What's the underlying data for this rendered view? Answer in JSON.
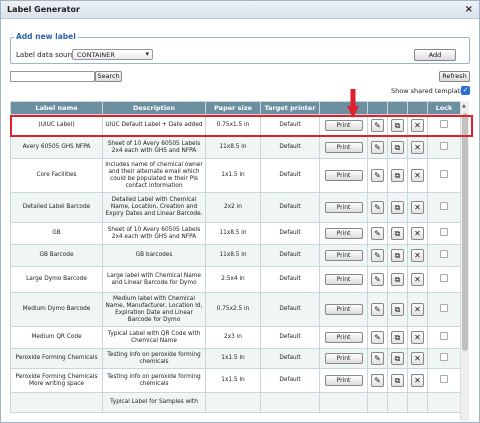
{
  "window": {
    "title": "Label Generator",
    "close": "×"
  },
  "add_section": {
    "legend": "Add new label",
    "source_label": "Label data source:",
    "source_value": "CONTAINER",
    "add_label": "Add"
  },
  "search": {
    "button": "Search",
    "value": ""
  },
  "refresh_label": "Refresh",
  "shared_templates": {
    "label": "Show shared templates:",
    "checked": true
  },
  "table": {
    "headers": [
      "Label name",
      "Description",
      "Paper size",
      "Target printer",
      "",
      "",
      "",
      "",
      "Lock"
    ],
    "print_label": "Print",
    "rows": [
      {
        "name": "(UIUC Label)",
        "desc": "UIUC Default Label + Date added",
        "paper": "0.75x1.5 in",
        "printer": "Default"
      },
      {
        "name": "Avery 60505 GHS NFPA",
        "desc": "Sheet of 10 Avery 60505 Labels 2x4 each with GHS and NFPA",
        "paper": "11x8.5 in",
        "printer": "Default"
      },
      {
        "name": "Core Facilities",
        "desc": "Includes name of chemical owner and their alternate email which could be populated w their PIs contact information",
        "paper": "1x1.5 in",
        "printer": "Default"
      },
      {
        "name": "Detailed Label Barcode",
        "desc": "Detailed Label with Chemical Name, Location, Creation and Expiry Dates and Linear Barcode.",
        "paper": "2x2 in",
        "printer": "Default"
      },
      {
        "name": "GB",
        "desc": "Sheet of 10 Avery 60505 Labels 2x4 each with GHS and NFPA",
        "paper": "11x8.5 in",
        "printer": "Default"
      },
      {
        "name": "GB Barcode",
        "desc": "GB barcodes",
        "paper": "11x8.5 in",
        "printer": "Default"
      },
      {
        "name": "Large Dymo Barcode",
        "desc": "Large label with Chemical Name and Linear Barcode for Dymo",
        "paper": "2.5x4 in",
        "printer": "Default"
      },
      {
        "name": "Medium Dymo Barcode",
        "desc": "Medium label with Chemical Name, Manufacturer, Location Id, Expiration Date and Linear Barcode for Dymo",
        "paper": "0.75x2.5 in",
        "printer": "Default"
      },
      {
        "name": "Medium QR Code",
        "desc": "Typical Label with QR Code with Chemical Name",
        "paper": "2x3 in",
        "printer": "Default"
      },
      {
        "name": "Peroxide Forming Chemicals",
        "desc": "Testing info on peroxide forming chemicals",
        "paper": "1x1.5 in",
        "printer": "Default"
      },
      {
        "name": "Peroxide Forming Chemicals More writing space",
        "desc": "Testing info on peroxide forming chemicals",
        "paper": "1x1.5 in",
        "printer": "Default"
      },
      {
        "name": "",
        "desc": "Typical Label for Samples with",
        "paper": "",
        "printer": ""
      }
    ]
  },
  "colors": {
    "header": "#6b8f9f",
    "highlight": "#e0202a",
    "legend": "#2a62a6"
  }
}
